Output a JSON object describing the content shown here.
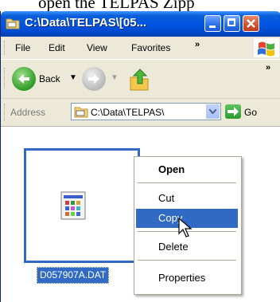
{
  "caption": "open the TELPAS Zipp",
  "window": {
    "title": "C:\\Data\\TELPAS\\[05..."
  },
  "menu": {
    "items": [
      "File",
      "Edit",
      "View",
      "Favorites"
    ],
    "overflow": "»"
  },
  "toolbar": {
    "back_label": "Back",
    "overflow": "»"
  },
  "address": {
    "label": "Address",
    "value": "C:\\Data\\TELPAS\\",
    "go_label": "Go"
  },
  "file": {
    "name": "D057907A.DAT"
  },
  "context_menu": {
    "open": "Open",
    "cut": "Cut",
    "copy": "Copy",
    "delete": "Delete",
    "properties": "Properties"
  },
  "colors": {
    "titlebar": "#0054e3",
    "selection": "#316ac5",
    "toolbar_bg": "#ece9d8"
  }
}
